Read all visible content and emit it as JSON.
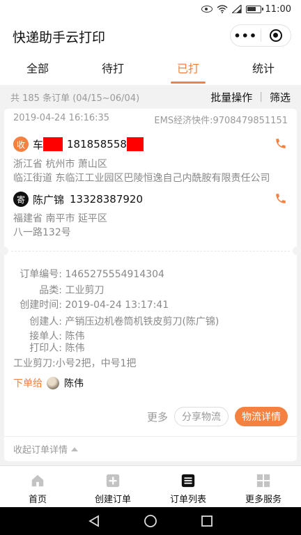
{
  "status_bar": {
    "time": "11:00"
  },
  "header": {
    "title": "快递助手云打印",
    "more_label": "•••"
  },
  "tabs": [
    {
      "label": "全部"
    },
    {
      "label": "待打"
    },
    {
      "label": "已打"
    },
    {
      "label": "统计"
    }
  ],
  "active_tab": "已打",
  "summary": {
    "count_text": "共 185 条订单 (04/15~06/04)",
    "batch_label": "批量操作",
    "separator": "|",
    "filter_label": "筛选"
  },
  "order": {
    "created_at": "2019-04-24 16:16:35",
    "express": "EMS经济快件:9708479851151",
    "receiver": {
      "badge": "收",
      "name": "车",
      "phone": "181858558",
      "address_line1": "浙江省 杭州市 萧山区",
      "address_line2": "临江街道 东临江工业园区巴陵恒逸自己内酰胺有限责任公司"
    },
    "sender": {
      "badge": "寄",
      "name": "陈广锦",
      "phone": "13328387920",
      "address_line1": "福建省 南平市 延平区",
      "address_line2": "八一路132号"
    },
    "details": {
      "order_no_label": "订单编号:",
      "order_no": "1465275554914304",
      "category_label": "品类:",
      "category": "工业剪刀",
      "created_label": "创建时间:",
      "created": "2019-04-24 13:17:41",
      "creator_label": "创建人:",
      "creator": "产销压边机卷筒机铁皮剪刀(陈广锦)",
      "accepter_label": "接单人:",
      "accepter": "陈伟",
      "printer_label": "打印人:",
      "printer": "陈伟",
      "items_text": "工业剪刀:小号2把，中号1把"
    },
    "assign_label": "下单给",
    "assignee": "陈伟",
    "more_label": "更多",
    "share_label": "分享物流",
    "logistics_label": "物流详情",
    "collapse_label": "收起订单详情"
  },
  "bottom_nav": [
    {
      "label": "首页",
      "icon": "home-icon"
    },
    {
      "label": "创建订单",
      "icon": "plus-icon"
    },
    {
      "label": "订单列表",
      "icon": "list-icon"
    },
    {
      "label": "更多服务",
      "icon": "grid-icon"
    }
  ],
  "colors": {
    "accent": "#f4813f",
    "text_primary": "#111111",
    "text_muted": "#888888",
    "background": "#f2f2f2"
  }
}
